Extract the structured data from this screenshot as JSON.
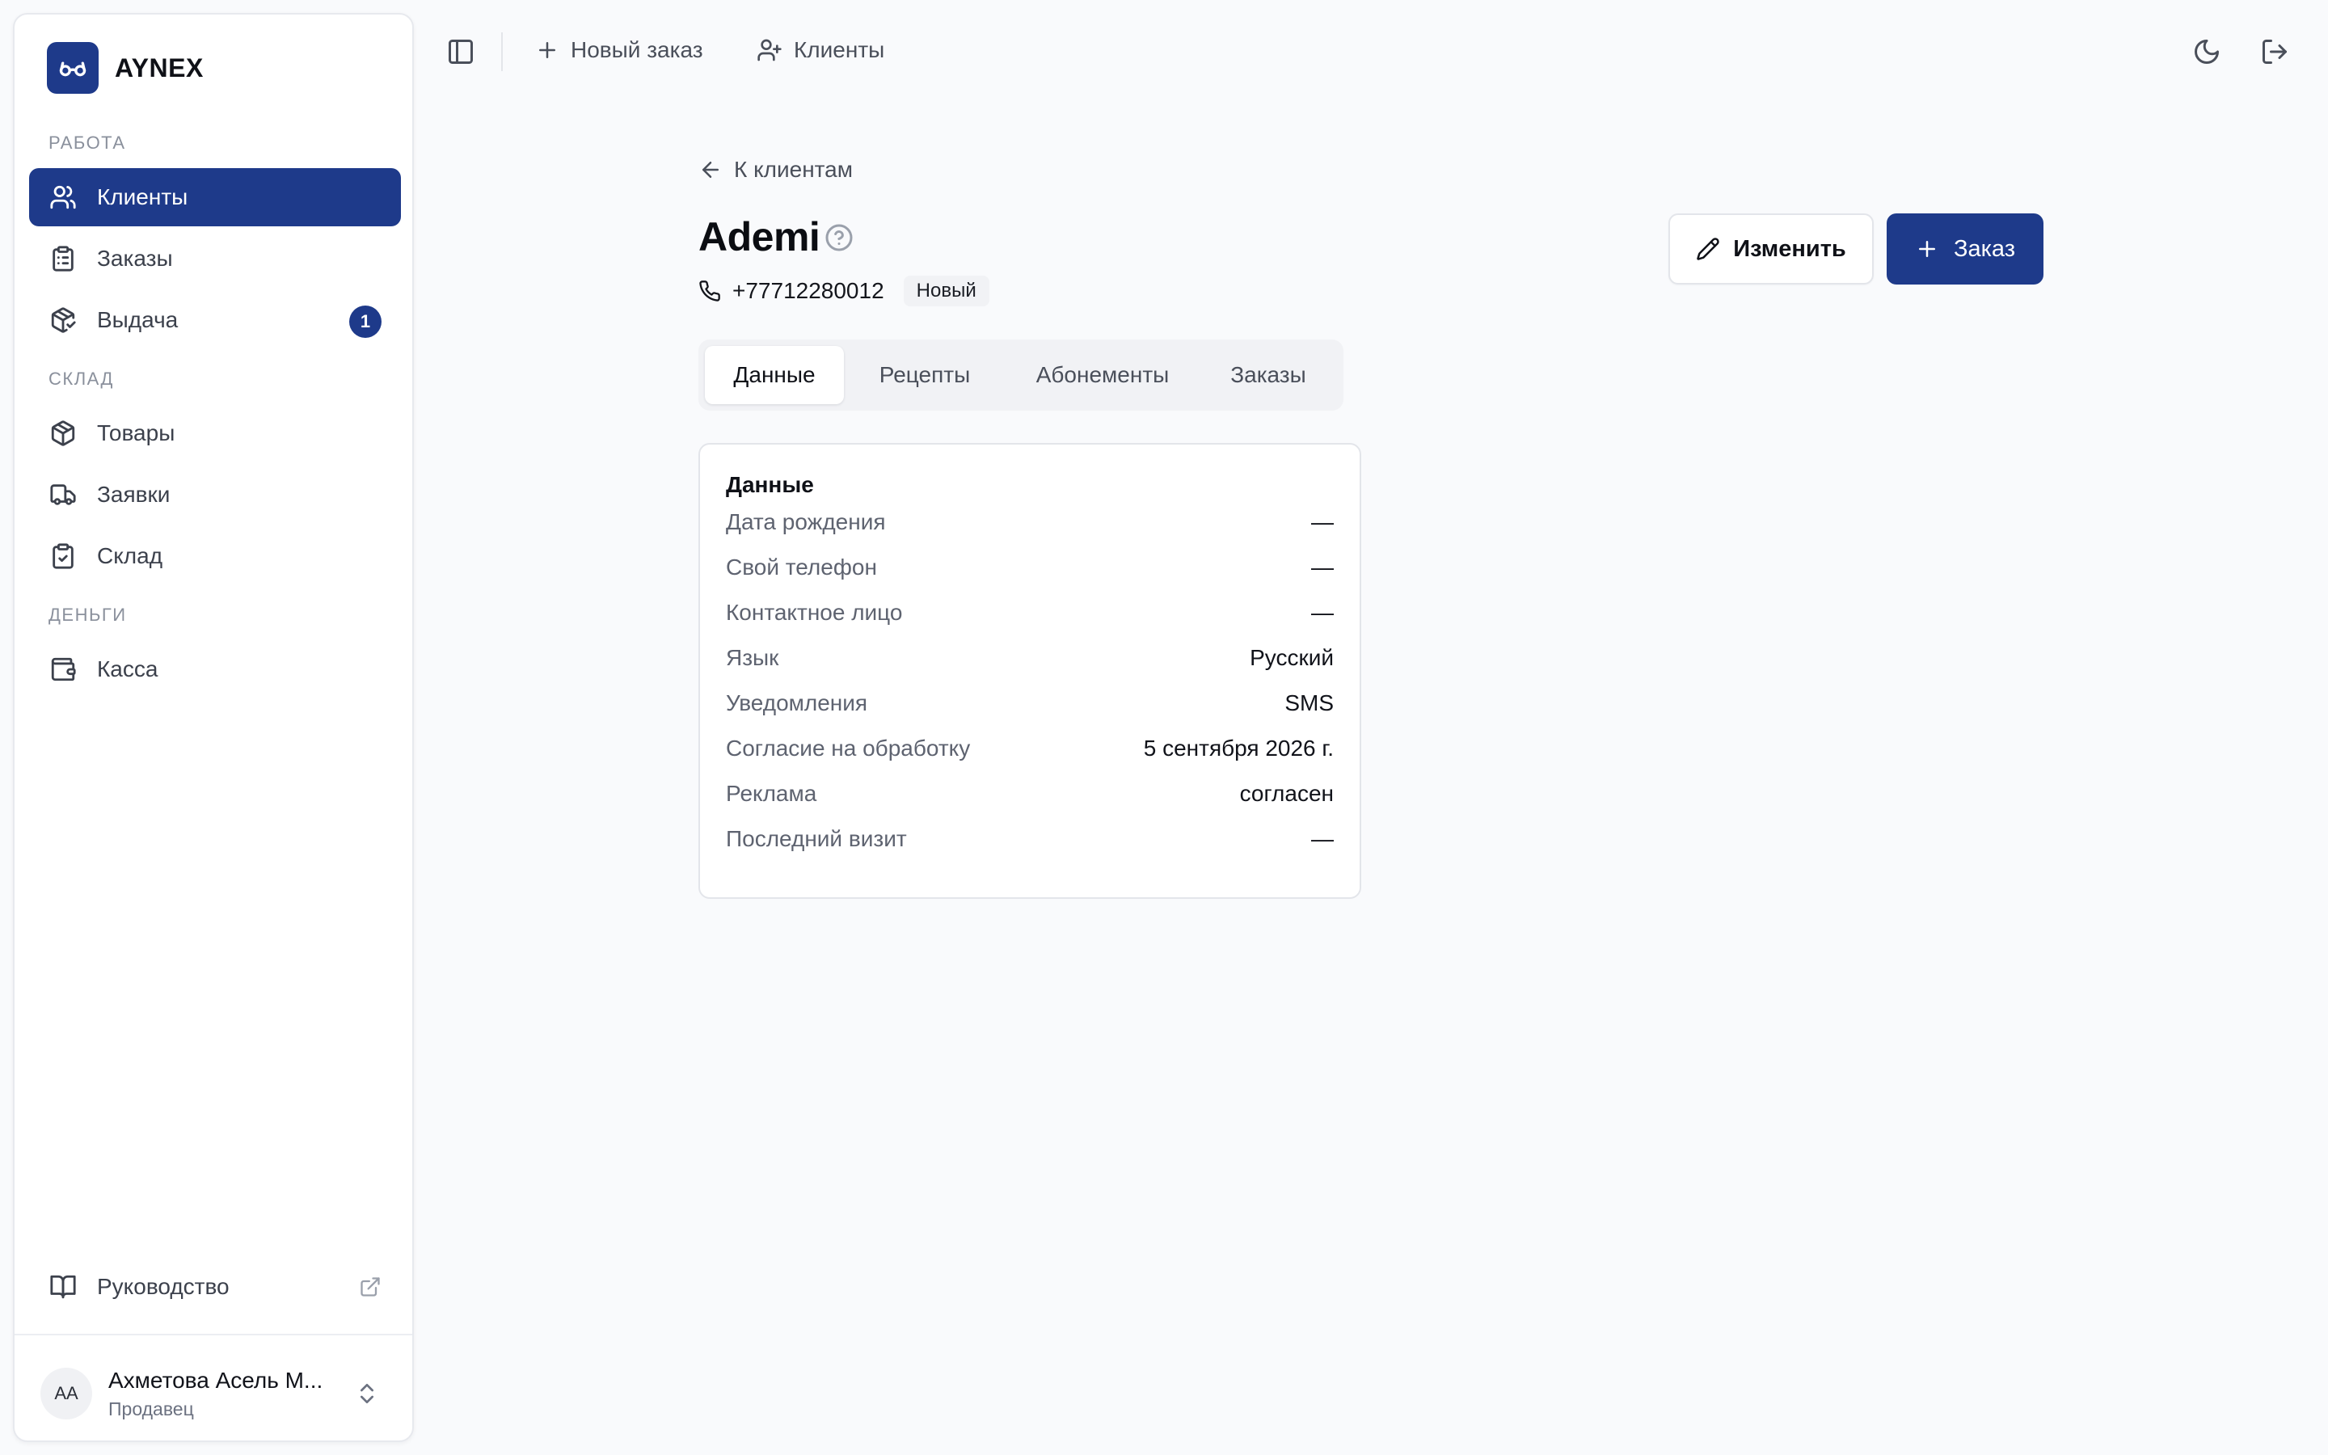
{
  "brand": {
    "name": "AYNEX",
    "logo_icon": "glasses-icon",
    "accent": "#1e3a8a"
  },
  "sidebar": {
    "sections": {
      "work": "РАБОТА",
      "warehouse": "СКЛАД",
      "money": "ДЕНЬГИ"
    },
    "items": [
      {
        "label": "Клиенты",
        "icon": "users-icon",
        "active": true
      },
      {
        "label": "Заказы",
        "icon": "clipboard-list-icon"
      },
      {
        "label": "Выдача",
        "icon": "package-check-icon",
        "badge": "1"
      },
      {
        "label": "Товары",
        "icon": "package-icon"
      },
      {
        "label": "Заявки",
        "icon": "truck-icon"
      },
      {
        "label": "Склад",
        "icon": "clipboard-check-icon"
      },
      {
        "label": "Касса",
        "icon": "wallet-icon"
      }
    ],
    "guide": {
      "label": "Руководство",
      "icon": "book-open-icon",
      "ext_icon": "external-link-icon"
    },
    "user": {
      "initials": "АА",
      "name": "Ахметова Асель М...",
      "role": "Продавец"
    }
  },
  "topbar": {
    "new_order": "Новый заказ",
    "clients": "Клиенты"
  },
  "client": {
    "back_label": "К клиентам",
    "name": "Ademi",
    "phone": "+77712280012",
    "status": "Новый",
    "edit_label": "Изменить",
    "order_label": "Заказ"
  },
  "tabs": [
    {
      "label": "Данные",
      "active": true
    },
    {
      "label": "Рецепты"
    },
    {
      "label": "Абонементы"
    },
    {
      "label": "Заказы"
    }
  ],
  "details": {
    "title": "Данные",
    "rows": [
      {
        "label": "Дата рождения",
        "value": "—"
      },
      {
        "label": "Свой телефон",
        "value": "—"
      },
      {
        "label": "Контактное лицо",
        "value": "—"
      },
      {
        "label": "Язык",
        "value": "Русский"
      },
      {
        "label": "Уведомления",
        "value": "SMS"
      },
      {
        "label": "Согласие на обработку",
        "value": "5 сентября 2026 г."
      },
      {
        "label": "Реклама",
        "value": "согласен"
      },
      {
        "label": "Последний визит",
        "value": "—"
      }
    ]
  }
}
